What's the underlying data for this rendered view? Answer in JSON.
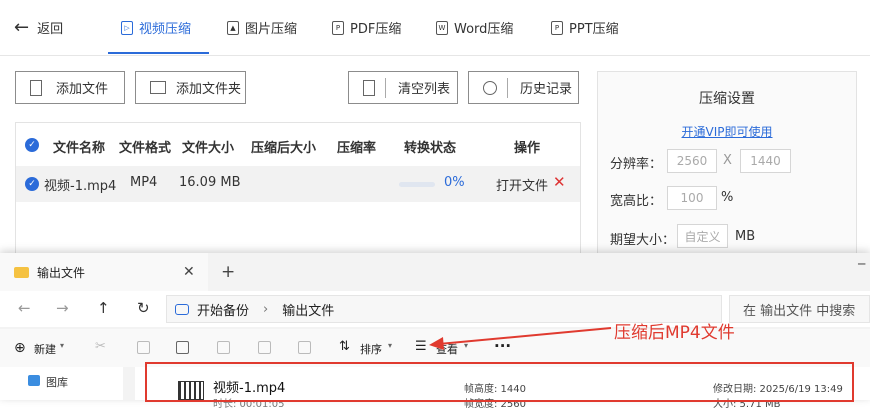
{
  "app": {
    "back_label": "返回",
    "tabs": [
      {
        "label": "视频压缩",
        "active": true
      },
      {
        "label": "图片压缩",
        "active": false
      },
      {
        "label": "PDF压缩",
        "active": false
      },
      {
        "label": "Word压缩",
        "active": false
      },
      {
        "label": "PPT压缩",
        "active": false
      }
    ],
    "toolbar": {
      "add_file": "添加文件",
      "add_folder": "添加文件夹",
      "clear_list": "清空列表",
      "history": "历史记录"
    },
    "table": {
      "columns": [
        "文件名称",
        "文件格式",
        "文件大小",
        "压缩后大小",
        "压缩率",
        "转换状态",
        "操作"
      ],
      "rows": [
        {
          "name": "视频-1.mp4",
          "format": "MP4",
          "size": "16.09 MB",
          "compressed_size": "",
          "ratio": "",
          "progress_percent": 0,
          "status": "0%",
          "open": "打开文件"
        }
      ]
    },
    "settings": {
      "title": "压缩设置",
      "vip_link": "开通VIP即可使用",
      "resolution_label": "分辨率：",
      "res_w_placeholder": "2560",
      "res_x": "X",
      "res_h_placeholder": "1440",
      "aspect_label": "宽高比：",
      "aspect_placeholder": "100",
      "aspect_unit": "%",
      "size_label": "期望大小：",
      "size_placeholder": "自定义",
      "size_unit": "MB"
    }
  },
  "explorer": {
    "tab_title": "输出文件",
    "breadcrumb": [
      "开始备份",
      "输出文件"
    ],
    "search_placeholder": "在 输出文件 中搜索",
    "commands": {
      "new": "新建",
      "sort": "排序",
      "view": "查看"
    },
    "sidebar_items": [
      "图库"
    ],
    "files": [
      {
        "name": "视频-1.mp4",
        "duration_label": "时长: 00:01:05",
        "frame_height": "帧高度: 1440",
        "frame_width": "帧宽度: 2560",
        "modified": "修改日期: 2025/6/19 13:49",
        "size": "大小: 5.71 MB"
      }
    ]
  },
  "annotation": {
    "text": "压缩后MP4文件",
    "color": "#e03a2f"
  },
  "colors": {
    "accent": "#2b6bd9",
    "danger": "#d33333"
  }
}
